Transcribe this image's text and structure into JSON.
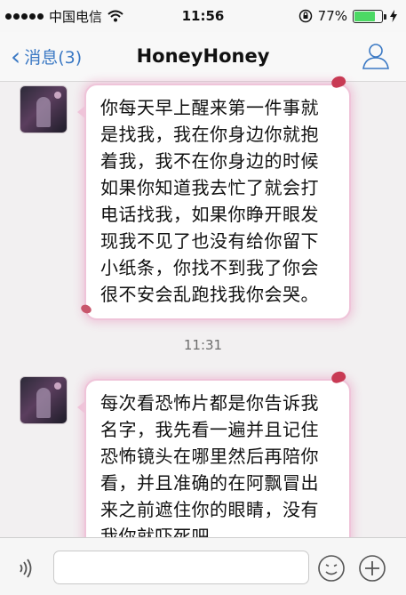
{
  "status_bar": {
    "carrier": "中国电信",
    "time": "11:56",
    "battery_percent": "77%",
    "battery_level": 0.77
  },
  "nav": {
    "back_label": "消息(3)",
    "title": "HoneyHoney"
  },
  "messages": [
    {
      "text": "你每天早上醒来第一件事就是找我，我在你身边你就抱着我，我不在你身边的时候如果你知道我去忙了就会打电话找我，如果你睁开眼发现我不见了也没有给你留下小纸条，你找不到我了你会很不安会乱跑找我你会哭。"
    },
    {
      "text": "每次看恐怖片都是你告诉我名字，我先看一遍并且记住恐怖镜头在哪里然后再陪你看，并且准确的在阿飘冒出来之前遮住你的眼睛，没有我你就吓死吧。"
    }
  ],
  "timestamp": "11:31",
  "input": {
    "placeholder": ""
  },
  "colors": {
    "accent": "#3b79c4",
    "bubble_glow": "#efc4d9",
    "battery": "#4cd964"
  },
  "icons": [
    "signal-dots-icon",
    "wifi-icon",
    "orientation-lock-icon",
    "battery-icon",
    "charging-icon",
    "back-chevron-icon",
    "profile-icon",
    "voice-icon",
    "emoji-icon",
    "plus-icon"
  ]
}
